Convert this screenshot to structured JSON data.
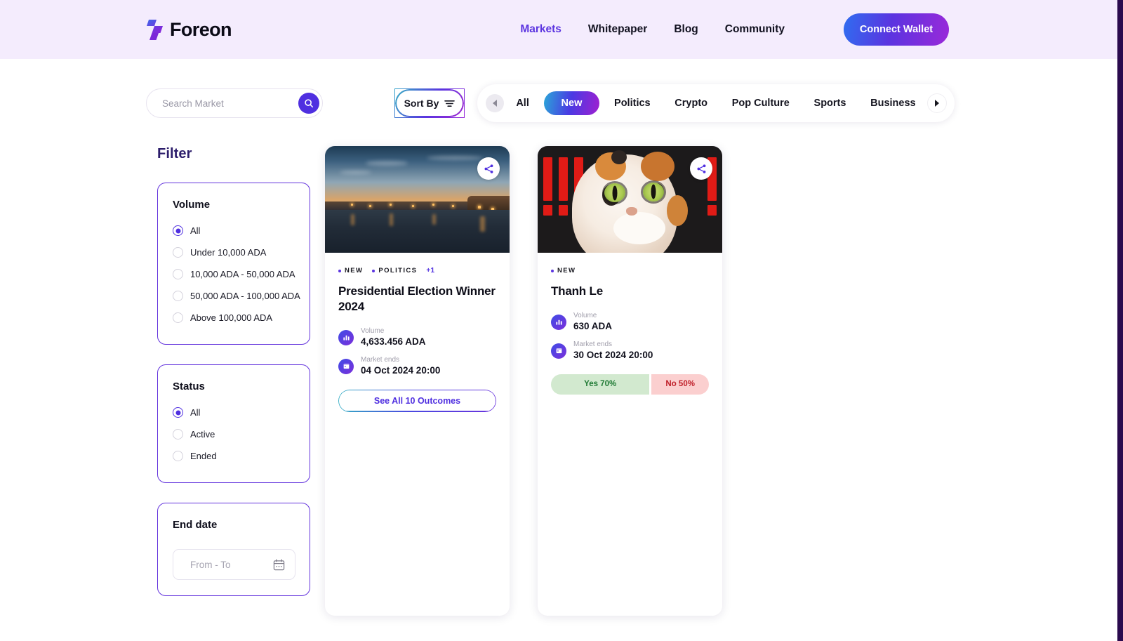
{
  "header": {
    "brand": "Foreon",
    "logo_icon": "foreon-logo-icon",
    "nav": [
      {
        "label": "Markets",
        "active": true
      },
      {
        "label": "Whitepaper",
        "active": false
      },
      {
        "label": "Blog",
        "active": false
      },
      {
        "label": "Community",
        "active": false
      }
    ],
    "connect_wallet_label": "Connect Wallet",
    "background_color": "#f4ecfd",
    "accent_color": "#5b34e0"
  },
  "controls": {
    "search": {
      "placeholder": "Search Market",
      "value": "",
      "icon": "search-icon"
    },
    "sort": {
      "label": "Sort By",
      "icon": "filter-lines-icon"
    },
    "tabs": {
      "prev_icon": "chevron-left-icon",
      "next_icon": "chevron-right-icon",
      "items": [
        {
          "label": "All",
          "active": false
        },
        {
          "label": "New",
          "active": true
        },
        {
          "label": "Politics",
          "active": false
        },
        {
          "label": "Crypto",
          "active": false
        },
        {
          "label": "Pop Culture",
          "active": false
        },
        {
          "label": "Sports",
          "active": false
        },
        {
          "label": "Business",
          "active": false
        }
      ],
      "active_gradient": "#2aa7d8 to #a01fd0"
    }
  },
  "filter": {
    "title": "Filter",
    "groups": [
      {
        "title": "Volume",
        "options": [
          {
            "label": "All",
            "selected": true
          },
          {
            "label": "Under 10,000 ADA",
            "selected": false
          },
          {
            "label": "10,000 ADA - 50,000 ADA",
            "selected": false
          },
          {
            "label": "50,000 ADA - 100,000 ADA",
            "selected": false
          },
          {
            "label": "Above 100,000 ADA",
            "selected": false
          }
        ]
      },
      {
        "title": "Status",
        "options": [
          {
            "label": "All",
            "selected": true
          },
          {
            "label": "Active",
            "selected": false
          },
          {
            "label": "Ended",
            "selected": false
          }
        ]
      }
    ],
    "end_date": {
      "title": "End date",
      "placeholder": "From - To",
      "value": "",
      "icon": "calendar-icon"
    },
    "border_color": "#6333dd"
  },
  "cards": [
    {
      "media": "city-sunset-photo",
      "share_icon": "share-icon",
      "tags": [
        "NEW",
        "POLITICS"
      ],
      "extra_tags": "+1",
      "title": "Presidential Election Winner 2024",
      "stats": [
        {
          "icon": "bar-chart-icon",
          "label": "Volume",
          "value": "4,633.456 ADA"
        },
        {
          "icon": "calendar-icon",
          "label": "Market ends",
          "value": "04 Oct 2024 20:00"
        }
      ],
      "action": {
        "type": "outcomes",
        "label": "See All 10 Outcomes"
      }
    },
    {
      "media": "surprised-cat-photo",
      "share_icon": "share-icon",
      "tags": [
        "NEW"
      ],
      "extra_tags": "",
      "title": "Thanh Le",
      "stats": [
        {
          "icon": "bar-chart-icon",
          "label": "Volume",
          "value": "630 ADA"
        },
        {
          "icon": "calendar-icon",
          "label": "Market ends",
          "value": "30 Oct 2024 20:00"
        }
      ],
      "action": {
        "type": "yesno",
        "yes_label": "Yes 70%",
        "no_label": "No 50%",
        "yes_color": "#1f7a34",
        "no_color": "#c0202a"
      }
    }
  ]
}
